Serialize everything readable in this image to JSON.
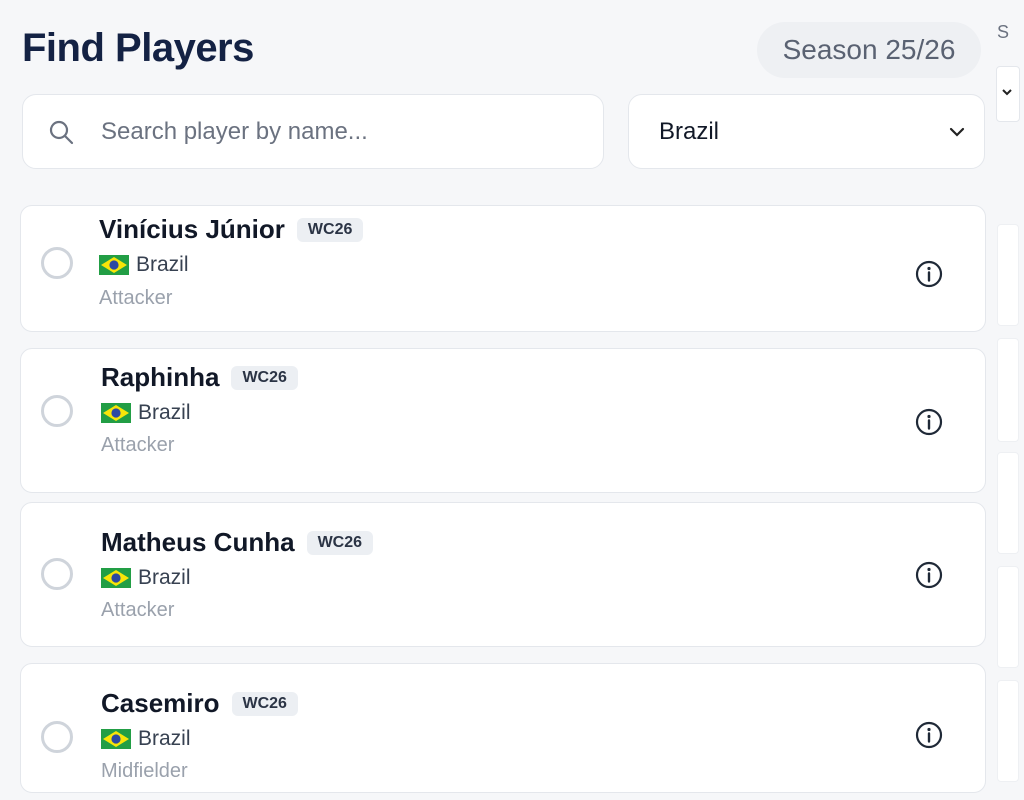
{
  "header": {
    "title": "Find Players",
    "season": "Season 25/26"
  },
  "search": {
    "placeholder": "Search player by name..."
  },
  "filter": {
    "selected": "Brazil"
  },
  "players": [
    {
      "name": "Vinícius Júnior",
      "badge": "WC26",
      "country": "Brazil",
      "position": "Attacker"
    },
    {
      "name": "Raphinha",
      "badge": "WC26",
      "country": "Brazil",
      "position": "Attacker"
    },
    {
      "name": "Matheus Cunha",
      "badge": "WC26",
      "country": "Brazil",
      "position": "Attacker"
    },
    {
      "name": "Casemiro",
      "badge": "WC26",
      "country": "Brazil",
      "position": "Midfielder"
    }
  ],
  "right_panel": {
    "partial_text": "S"
  },
  "icons": {
    "search": "search-icon",
    "dropdown": "chevron-down-icon",
    "info": "info-icon",
    "flag": "brazil-flag-icon"
  },
  "colors": {
    "title": "#142244",
    "background": "#f6f7f9",
    "card": "#ffffff",
    "badge_bg": "#eceff3"
  }
}
